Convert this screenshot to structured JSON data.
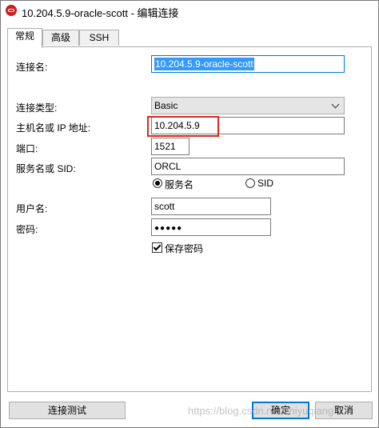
{
  "window": {
    "title": "10.204.5.9-oracle-scott - 编辑连接"
  },
  "tabs": [
    {
      "label": "常规",
      "active": true
    },
    {
      "label": "高级",
      "active": false
    },
    {
      "label": "SSH",
      "active": false
    }
  ],
  "form": {
    "connection_name_label": "连接名:",
    "connection_name_value": "10.204.5.9-oracle-scott",
    "connection_type_label": "连接类型:",
    "connection_type_value": "Basic",
    "host_label": "主机名或 IP 地址:",
    "host_value": "10.204.5.9",
    "port_label": "端口:",
    "port_value": "1521",
    "service_label": "服务名或 SID:",
    "service_value": "ORCL",
    "radio_service_name": "服务名",
    "radio_sid": "SID",
    "username_label": "用户名:",
    "username_value": "scott",
    "password_label": "密码:",
    "password_value": "●●●●●",
    "save_password_label": "保存密码"
  },
  "buttons": {
    "test_connection": "连接测试",
    "ok": "确定",
    "cancel": "取消"
  },
  "watermark": "https://blog.csdn.net/zhiyuqiang",
  "colors": {
    "accent": "#0078d7",
    "selection": "#3399ff",
    "highlight_box": "#e0261d",
    "app_icon": "#c8201e"
  }
}
